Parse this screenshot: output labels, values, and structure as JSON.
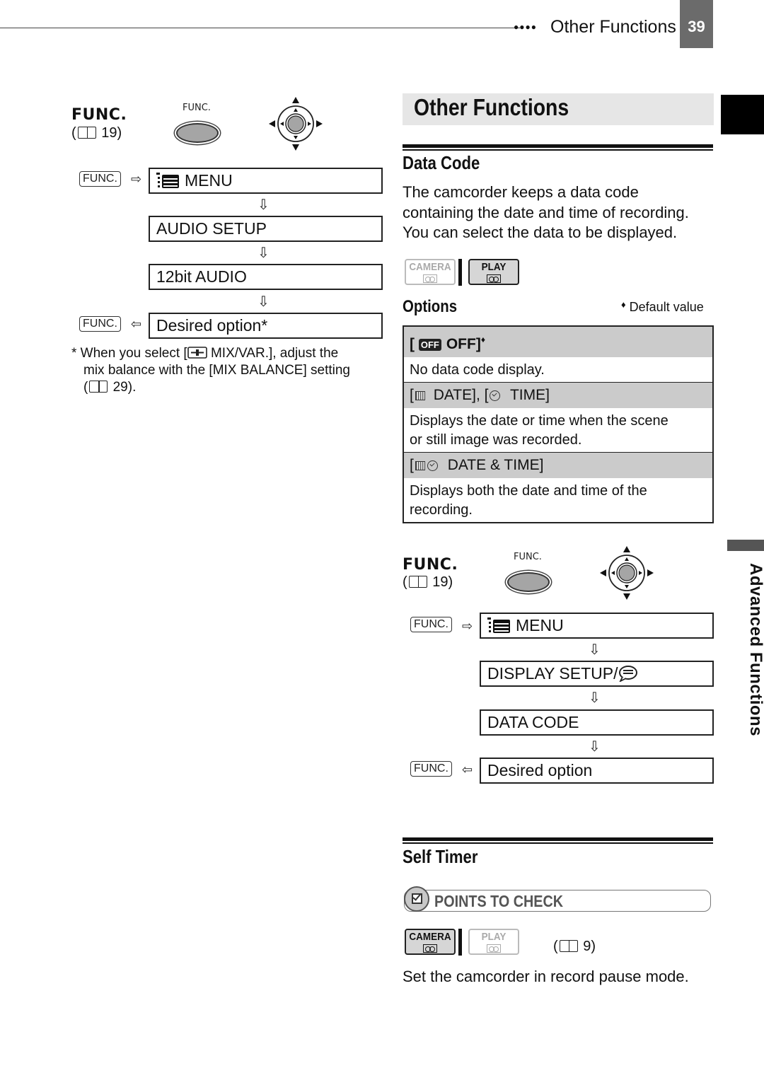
{
  "header": {
    "dots": "●●●●",
    "section_title": "Other Functions",
    "page_number": "39"
  },
  "left_procedure": {
    "func_title": "FUNC.",
    "ref_open": "(",
    "ref_page": "19)",
    "button_label": "FUNC.",
    "func_key": "FUNC.",
    "steps": [
      "MENU",
      "AUDIO  SETUP",
      "12bit AUDIO",
      "Desired option*"
    ],
    "arrow_right": "⇨",
    "arrow_left": "⇦",
    "arrow_down": "⇩",
    "footnote_line1": "* When you select [",
    "footnote_line1b": " MIX/VAR.], adjust the",
    "footnote_line2": "mix balance with the [MIX BALANCE] setting",
    "footnote_line3_open": "(",
    "footnote_line3_page": "29)."
  },
  "main": {
    "title": "Other Functions",
    "data_code": {
      "heading": "Data Code",
      "description": [
        "The camcorder keeps a data code",
        "containing the date and time of recording.",
        "You can select the data to be displayed."
      ],
      "modes": {
        "camera": {
          "label": "CAMERA",
          "active": false
        },
        "play": {
          "label": "PLAY",
          "active": true
        }
      },
      "options_heading": "Options",
      "default_marker": "♦",
      "default_legend": "Default value",
      "options": [
        {
          "icon": "off-icon",
          "icon_text": "OFF",
          "label": "OFF]",
          "default": true,
          "description": [
            "No data code display."
          ]
        },
        {
          "label_a": "DATE], [",
          "label_b": "TIME]",
          "description": [
            "Displays the date or time when the scene",
            "or still image was recorded."
          ]
        },
        {
          "label": "DATE & TIME]",
          "description": [
            "Displays both the date and time of the",
            "recording."
          ]
        }
      ]
    },
    "procedure": {
      "func_title": "FUNC.",
      "ref_open": "(",
      "ref_page": "19)",
      "button_label": "FUNC.",
      "func_key": "FUNC.",
      "steps": [
        "MENU",
        "DISPLAY SETUP/",
        "DATA CODE",
        "Desired option"
      ]
    },
    "self_timer": {
      "heading": "Self Timer",
      "points_to_check": "POINTS TO CHECK",
      "modes": {
        "camera": {
          "label": "CAMERA",
          "active": true
        },
        "play": {
          "label": "PLAY",
          "active": false
        }
      },
      "ref_open": "(",
      "ref_page": "9)",
      "instruction": "Set the camcorder in record pause mode."
    }
  },
  "side_tab": {
    "label": "Advanced Functions"
  }
}
